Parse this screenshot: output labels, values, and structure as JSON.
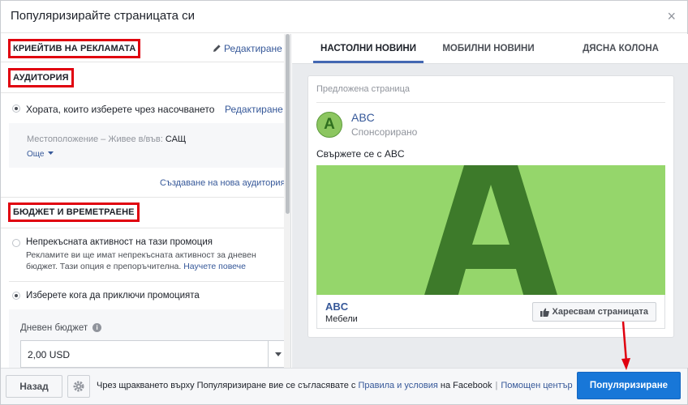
{
  "header": {
    "title": "Популяризирайте страницата си",
    "close": "×"
  },
  "left": {
    "creative": {
      "title": "КРИЕЙТИВ НА РЕКЛАМАТА",
      "edit": "Редактиране"
    },
    "audience": {
      "title": "АУДИТОРИЯ",
      "option": "Хората, които изберете чрез насочването",
      "edit": "Редактиране",
      "location_label": "Местоположение – Живее в/във:",
      "location_value": "САЩ",
      "more": "Още",
      "create_new": "Създаване на нова аудитория"
    },
    "budget": {
      "title": "БЮДЖЕТ И ВРЕМЕТРАЕНЕ",
      "continuous_title": "Непрекъсната активност на тази промоция",
      "continuous_desc_1": "Рекламите ви ще имат непрекъсната активност за дневен",
      "continuous_desc_2": "бюджет. Тази опция е препоръчителна.",
      "learn_more": "Научете повече",
      "choose_end": "Изберете кога да приключи промоцията",
      "daily_label": "Дневен бюджет",
      "daily_value": "2,00 USD"
    }
  },
  "tabs": [
    "НАСТОЛНИ НОВИНИ",
    "МОБИЛНИ НОВИНИ",
    "ДЯСНА КОЛОНА"
  ],
  "preview": {
    "suggested": "Предложена страница",
    "avatar_letter": "A",
    "page_name": "ABC",
    "sponsored": "Спонсорирано",
    "ad_text": "Свържете се с ABC",
    "image_letter": "A",
    "foot_name": "ABC",
    "foot_category": "Мебели",
    "like_button": "Харесвам страницата"
  },
  "footer": {
    "back": "Назад",
    "terms_prefix": "Чрез щракването върху Популяризиране вие се съгласявате с",
    "terms_link": "Правила и условия",
    "terms_suffix": "на Facebook",
    "help_center": "Помощен център",
    "promote": "Популяризиране"
  },
  "colors": {
    "primary": "#1877d8",
    "link": "#365899",
    "highlight": "#e0000f",
    "image_bg": "#95d66b",
    "image_letter": "#3d7a2a"
  },
  "icons": [
    "close-icon",
    "pencil-icon",
    "dropdown-caret-icon",
    "info-icon",
    "thumbs-up-icon",
    "gear-icon",
    "annotation-arrow-icon"
  ]
}
